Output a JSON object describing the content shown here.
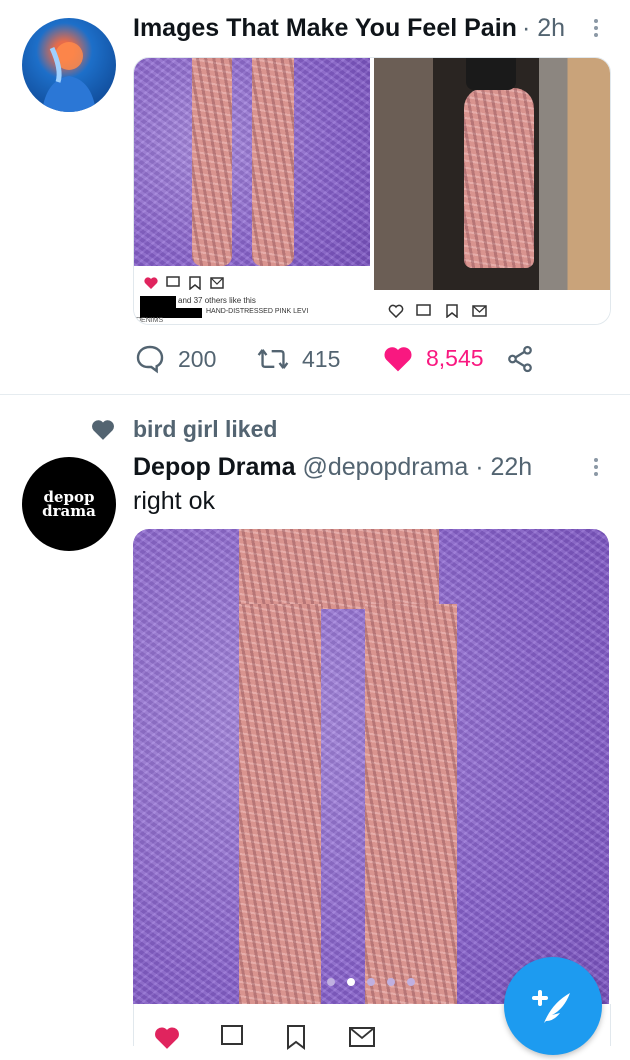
{
  "tweet1": {
    "author": "Images That Make You Feel Pain",
    "time": "2h",
    "sep": "·",
    "embedded": {
      "likes_text": "and 37 others like this",
      "caption": "HAND-DISTRESSED PINK LEVI",
      "caption2": "DENIMS"
    },
    "stats": {
      "replies": "200",
      "retweets": "415",
      "likes": "8,545"
    },
    "colors": {
      "like": "#f91880"
    }
  },
  "tweet2": {
    "social_context": "bird girl liked",
    "author": "Depop Drama",
    "handle": "@depopdrama",
    "sep": "·",
    "time": "22h",
    "text": "right ok",
    "avatar_text": "depop drama"
  },
  "icons": [
    "heart-icon",
    "reply-icon",
    "retweet-icon",
    "share-icon",
    "more-icon",
    "compose-icon"
  ],
  "accent": "#1d9bf0"
}
